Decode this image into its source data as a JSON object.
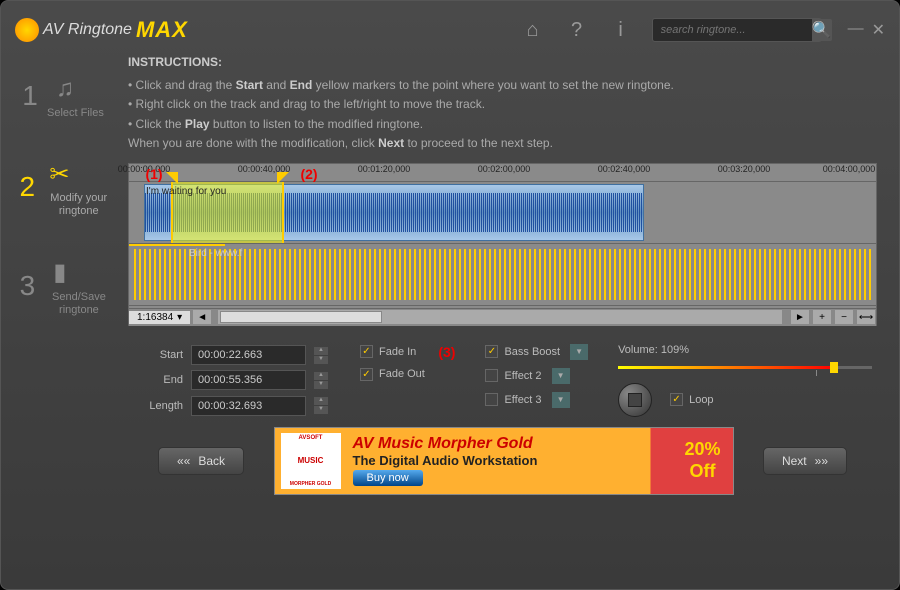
{
  "app": {
    "name": "AV Ringtone",
    "nameSuffix": "MAX"
  },
  "search": {
    "placeholder": "search ringtone..."
  },
  "steps": [
    {
      "num": "1",
      "label": "Select Files"
    },
    {
      "num": "2",
      "label": "Modify your ringtone"
    },
    {
      "num": "3",
      "label": "Send/Save ringtone"
    }
  ],
  "instructions": {
    "title": "INSTRUCTIONS:",
    "l1a": "• Click and drag the ",
    "l1b": "Start",
    "l1c": " and ",
    "l1d": "End",
    "l1e": " yellow markers to the point where you want to set the new ringtone.",
    "l2": "• Right click on the track and drag to the left/right to move the track.",
    "l3a": "• Click the ",
    "l3b": "Play",
    "l3c": " button to listen to the modified ringtone.",
    "l4a": "When you are done with the modification, click ",
    "l4b": "Next",
    "l4c": " to proceed to the next step."
  },
  "ruler": [
    "00:00:00,000",
    "00:00:40,000",
    "00:01:20,000",
    "00:02:00,000",
    "00:02:40,000",
    "00:03:20,000",
    "00:04:00,000"
  ],
  "tracks": {
    "t1": "I'm waiting for you",
    "t2": "Bird - www.f"
  },
  "annotations": {
    "a1": "(1)",
    "a2": "(2)",
    "a3": "(3)"
  },
  "zoom": "1:16384",
  "times": {
    "startLabel": "Start",
    "start": "00:00:22.663",
    "endLabel": "End",
    "end": "00:00:55.356",
    "lengthLabel": "Length",
    "length": "00:00:32.693"
  },
  "effects": {
    "fadeIn": "Fade In",
    "fadeOut": "Fade Out",
    "bassBoost": "Bass Boost",
    "effect2": "Effect 2",
    "effect3": "Effect 3"
  },
  "volume": {
    "label": "Volume: 109%",
    "loop": "Loop"
  },
  "nav": {
    "back": "Back",
    "next": "Next"
  },
  "banner": {
    "box1": "AVSOFT",
    "box2": "MUSIC",
    "box3": "MORPHER GOLD",
    "title": "AV Music Morpher Gold",
    "sub": "The Digital Audio Workstation",
    "btn": "Buy now",
    "off1": "20%",
    "off2": "Off"
  }
}
